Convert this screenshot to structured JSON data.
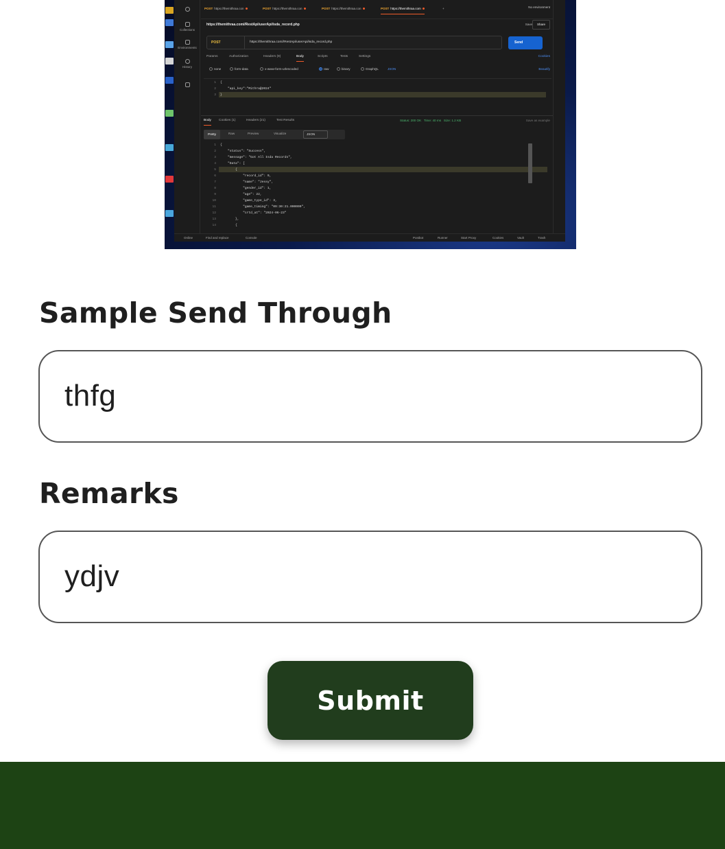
{
  "screenshot": {
    "sidebar": [
      "Collections",
      "Environments",
      "History"
    ],
    "tabs": [
      {
        "method": "POST",
        "label": "https://themithraa.con"
      },
      {
        "method": "POST",
        "label": "https://themithraa.con"
      },
      {
        "method": "POST",
        "label": "https://themithraa.con"
      },
      {
        "method": "POST",
        "label": "https://themithraa.com"
      }
    ],
    "new_tab": "+",
    "environment": "No environment",
    "request_title": "https://themithraa.com//RestApi/userApi/isda_record.php",
    "save": "Save",
    "share": "Share",
    "method": "POST",
    "url": "https://themithraa.com//RestApi/userApi/isda_record.php",
    "send": "Send",
    "request_tabs": [
      "Params",
      "Authorization",
      "Headers (9)",
      "Body",
      "Scripts",
      "Tests",
      "Settings"
    ],
    "cookies": "Cookies",
    "body_options": [
      "none",
      "form-data",
      "x-www-form-urlencoded",
      "raw",
      "binary",
      "GraphQL",
      "JSON"
    ],
    "beautify": "Beautify",
    "request_body": [
      "{",
      "    \"api_key\":\"Mithra@2024\"",
      "}"
    ],
    "response_tabs": [
      "Body",
      "Cookies (1)",
      "Headers (21)",
      "Test Results"
    ],
    "status": "Status: 200 OK",
    "time": "Time: 40 ms",
    "size": "Size: 1.2 KB",
    "save_example": "Save as example",
    "view_tabs": [
      "Pretty",
      "Raw",
      "Preview",
      "Visualize"
    ],
    "format": "JSON",
    "response_body": [
      "{",
      "    \"status\": \"Success\",",
      "    \"message\": \"Got All Isda Records\",",
      "    \"Data\": [",
      "        {",
      "            \"record_id\": 9,",
      "            \"name\": \"Jessy\",",
      "            \"gender_id\": 1,",
      "            \"age\": 22,",
      "            \"game_type_id\": 3,",
      "            \"game_timing\": \"09:30:21.000000\",",
      "            \"crtd_at\": \"2024-06-23\"",
      "        },",
      "        {"
    ],
    "status_bar": [
      "Online",
      "Find and replace",
      "Console",
      "Postbot",
      "Runner",
      "Start Proxy",
      "Cookies",
      "Vault",
      "Trash"
    ]
  },
  "form": {
    "sample_label": "Sample Send Through",
    "sample_value": "thfg",
    "remarks_label": "Remarks",
    "remarks_value": "ydjv",
    "submit_label": "Submit"
  },
  "colors": {
    "submit_bg": "#213d1d",
    "footer_bg": "#1d4314",
    "label_text": "#1f1f1f"
  }
}
